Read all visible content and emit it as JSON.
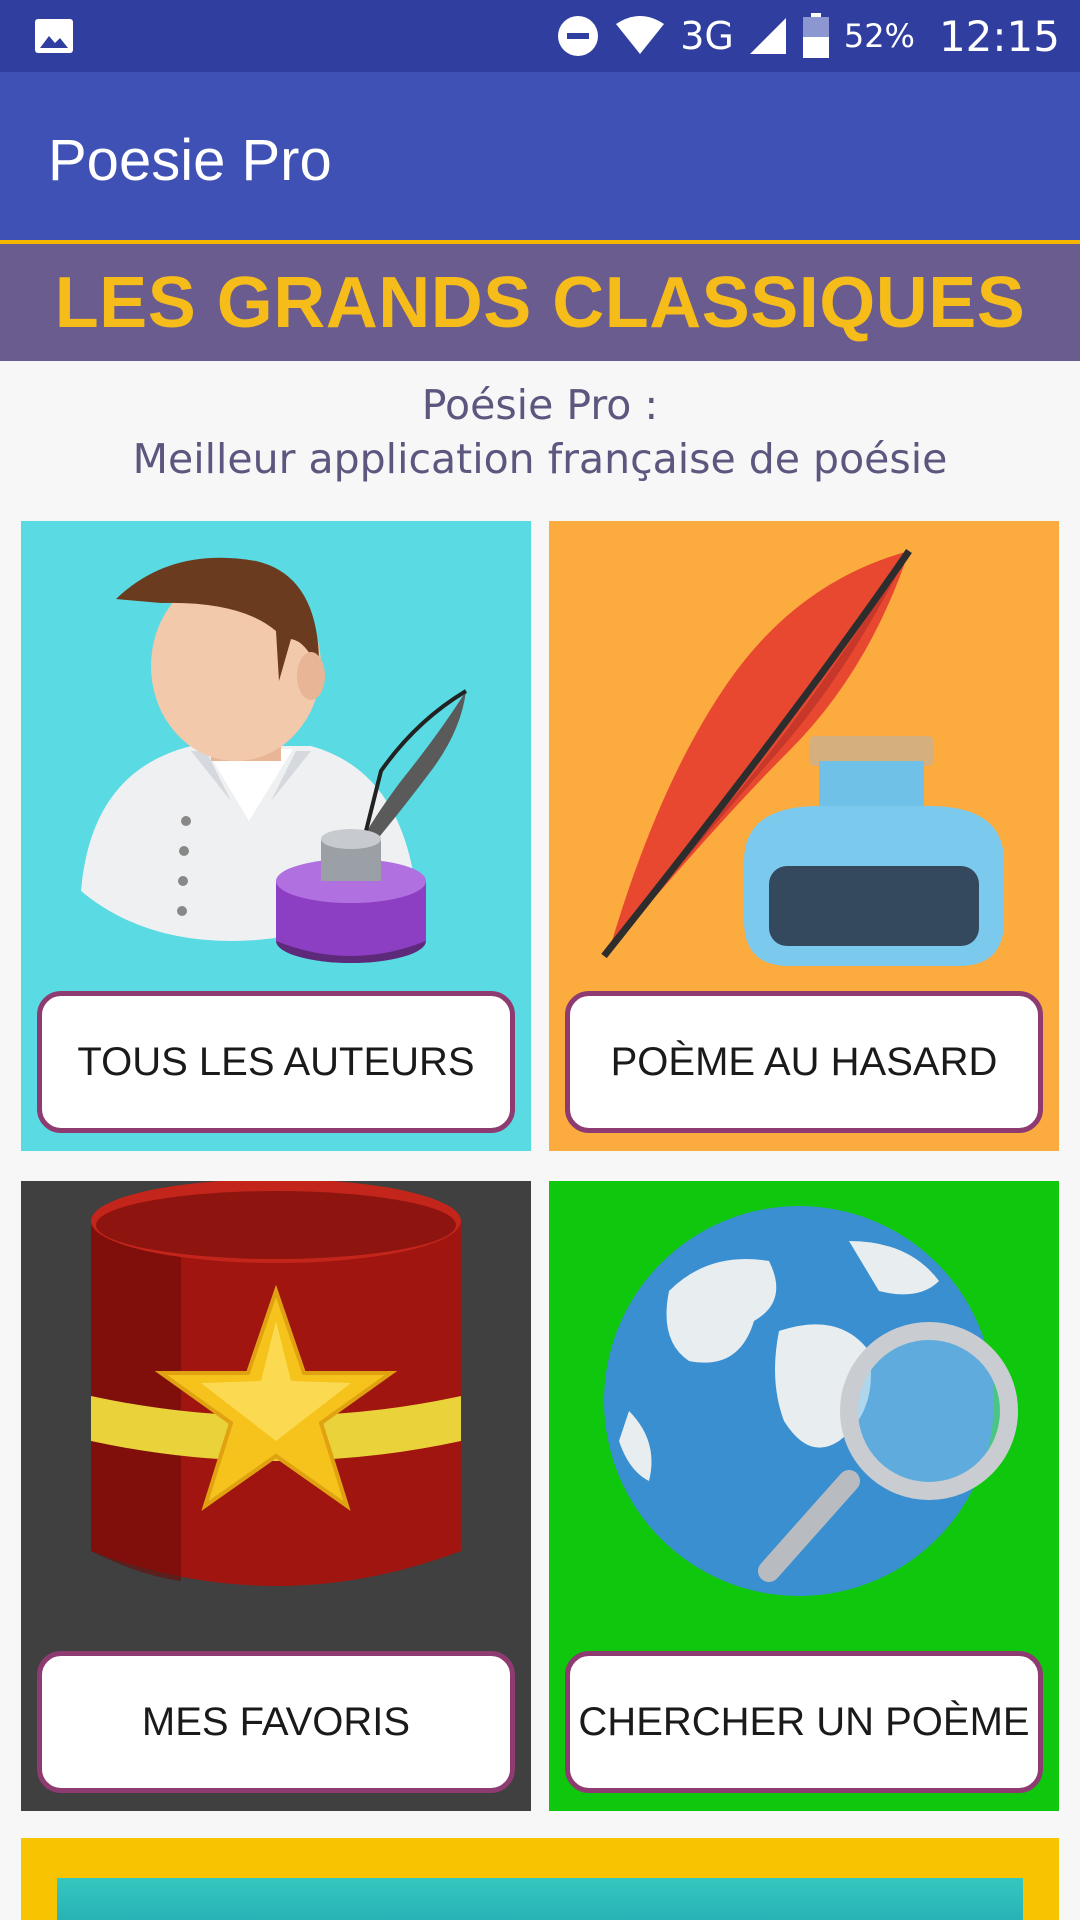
{
  "status_bar": {
    "network": "3G",
    "battery_percent": "52%",
    "time": "12:15",
    "icons": [
      "gallery-icon",
      "do-not-disturb-icon",
      "wifi-icon",
      "signal-icon",
      "battery-icon"
    ]
  },
  "app_bar": {
    "title": "Poesie Pro"
  },
  "banner": {
    "text": "LES GRANDS CLASSIQUES"
  },
  "subtitle": {
    "line1": "Poésie Pro :",
    "line2": "Meilleur application française de poésie"
  },
  "tiles": [
    {
      "label": "TOUS LES AUTEURS",
      "color": "#5adae2",
      "icon": "author-quill-icon"
    },
    {
      "label": "POÈME AU HASARD",
      "color": "#fcab3e",
      "icon": "quill-inkwell-icon"
    },
    {
      "label": "MES FAVORIS",
      "color": "#404040",
      "icon": "star-box-icon"
    },
    {
      "label": "CHERCHER UN POÈME",
      "color": "#0fc70d",
      "icon": "globe-search-icon"
    }
  ],
  "colors": {
    "status_bar": "#303f9f",
    "app_bar": "#3f51b5",
    "banner_bg": "#6a5c8e",
    "banner_text": "#f6bc1a",
    "button_border": "#8e3b71"
  }
}
